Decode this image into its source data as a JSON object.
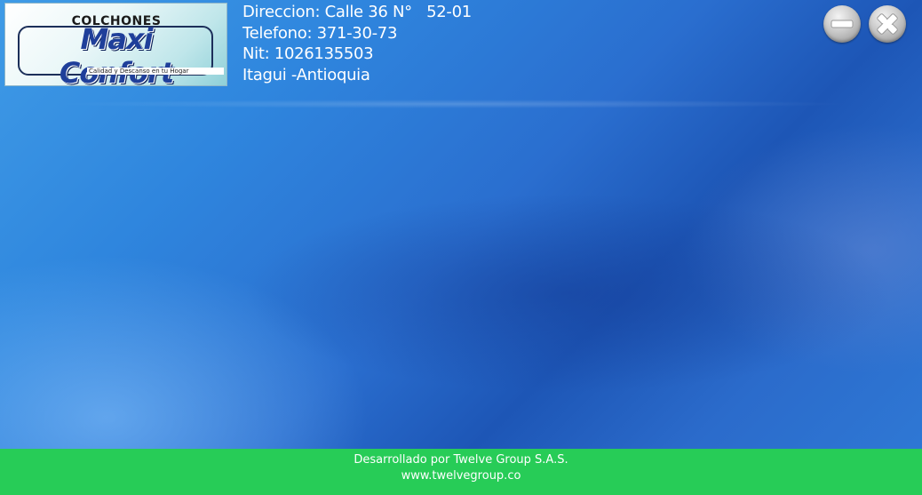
{
  "logo": {
    "top_text": "COLCHONES",
    "brand": "Maxi Confort",
    "slogan": "Calidad y Descanso en tu Hogar"
  },
  "company_info": {
    "address": "Direccion: Calle 36 N°   52-01",
    "phone": "Telefono: 371-30-73",
    "nit": "Nit: 1026135503",
    "city": "Itagui -Antioquia"
  },
  "window_controls": {
    "minimize_icon": "minus-icon",
    "close_icon": "close-icon"
  },
  "footer": {
    "developer": "Desarrollado por Twelve Group S.A.S.",
    "website": "www.twelvegroup.co"
  },
  "colors": {
    "footer_bg": "#27cc57",
    "background_blue": "#2a6ecf"
  }
}
